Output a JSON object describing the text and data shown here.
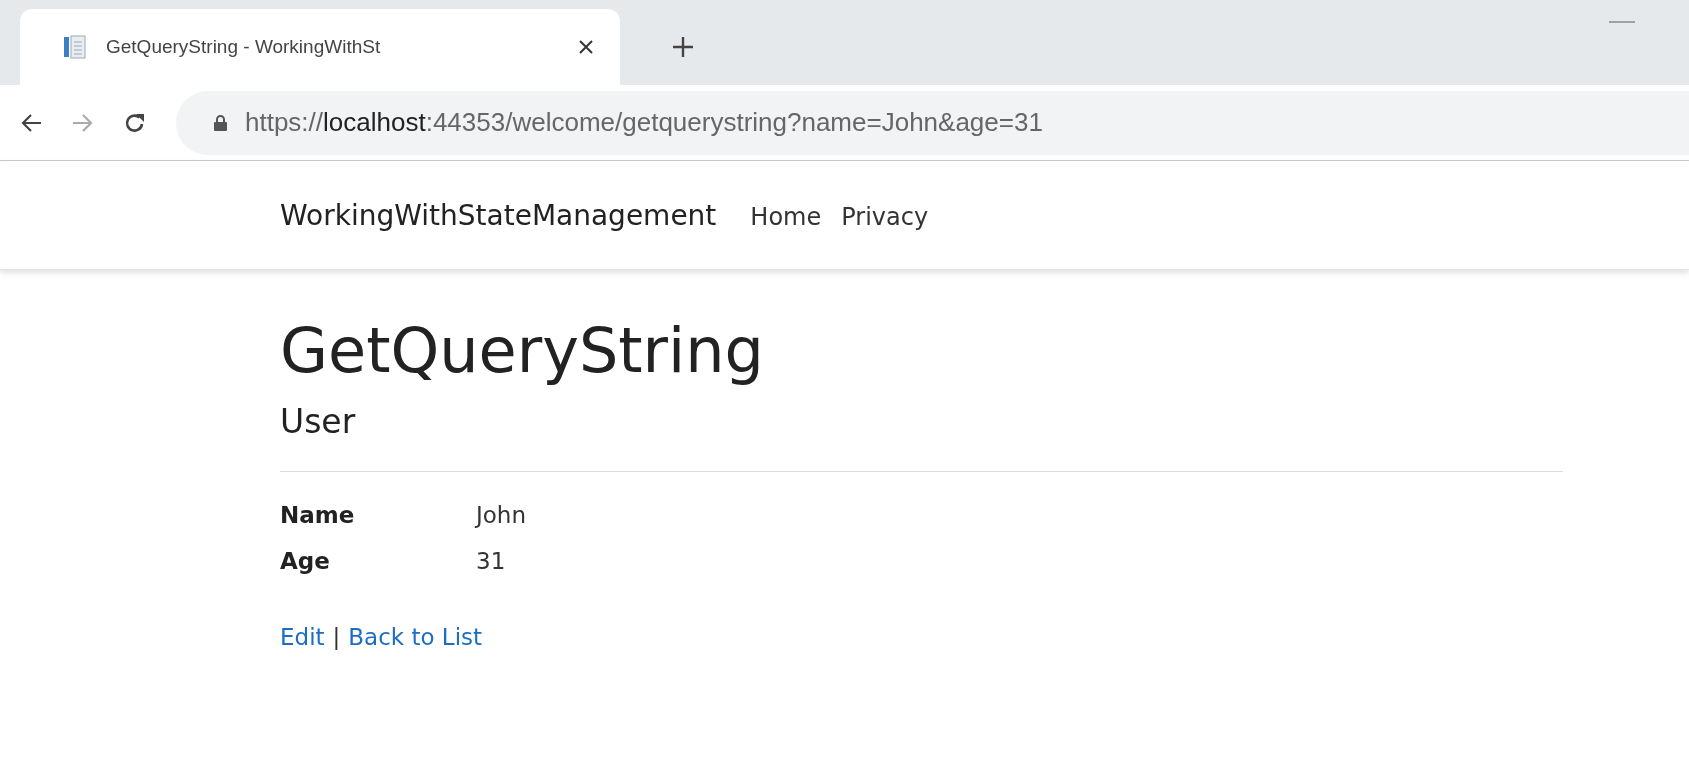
{
  "browser": {
    "tab": {
      "title": "GetQueryString - WorkingWithSt"
    },
    "address": {
      "scheme": "https://",
      "host": "localhost",
      "rest": ":44353/welcome/getquerystring?name=John&age=31"
    }
  },
  "navbar": {
    "brand": "WorkingWithStateManagement",
    "links": [
      "Home",
      "Privacy"
    ]
  },
  "page": {
    "title": "GetQueryString",
    "subtitle": "User",
    "fields": [
      {
        "label": "Name",
        "value": "John"
      },
      {
        "label": "Age",
        "value": "31"
      }
    ],
    "actions": [
      {
        "kind": "link",
        "text": "Edit"
      },
      {
        "kind": "separator",
        "text": "|"
      },
      {
        "kind": "link",
        "text": "Back to List"
      }
    ]
  }
}
